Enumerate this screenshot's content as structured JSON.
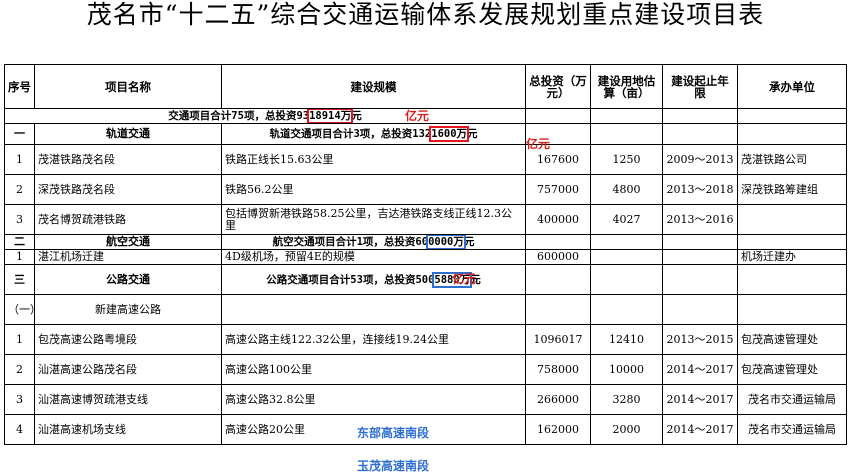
{
  "title": "茂名市“十二五”综合交通运输体系发展规划重点建设项目表",
  "headers": {
    "seq": "序号",
    "name": "项目名称",
    "scale": "建设规模",
    "invest": "总投资（万元）",
    "land": "建设用地估算（亩）",
    "years": "建设起止年限",
    "unit": "承办单位"
  },
  "total_row": {
    "prefix": "交通项目合计75项，总投资93",
    "boxed": "18914万",
    "suffix": "元"
  },
  "sections": {
    "rail": {
      "seq": "一",
      "name": "轨道交通",
      "sum_prefix": "轨道交通项目合计3项，总投资132",
      "sum_boxed": "1600万",
      "sum_suffix": "元"
    },
    "air": {
      "seq": "二",
      "name": "航空交通",
      "sum_prefix": "航空交通项目合计1项，总投资60",
      "sum_boxed": "0000万",
      "sum_suffix": "元"
    },
    "road": {
      "seq": "三",
      "name": "公路交通",
      "sum_prefix": "公路交通项目合计53项，总投资500",
      "sum_boxed": "5880万",
      "sum_suffix": "元"
    },
    "expressway": {
      "seq": "（一）",
      "name": "新建高速公路"
    }
  },
  "rows": [
    {
      "seq": "1",
      "name": "茂湛铁路茂名段",
      "scale": "铁路正线长15.63公里",
      "invest": "167600",
      "land": "1250",
      "years": "2009～2013",
      "unit": "茂湛铁路公司"
    },
    {
      "seq": "2",
      "name": "深茂铁路茂名段",
      "scale": "铁路56.2公里",
      "invest": "757000",
      "land": "4800",
      "years": "2013～2018",
      "unit": "深茂铁路筹建组"
    },
    {
      "seq": "3",
      "name": "茂名博贺疏港铁路",
      "scale": "包括博贺新港铁路58.25公里，吉达港铁路支线正线12.3公里",
      "invest": "400000",
      "land": "4027",
      "years": "2013～2016",
      "unit": ""
    },
    {
      "seq": "1",
      "name": "湛江机场迁建",
      "scale": "4D级机场，预留4E的规模",
      "invest": "600000",
      "land": "",
      "years": "",
      "unit": "机场迁建办"
    },
    {
      "seq": "1",
      "name": "包茂高速公路粤境段",
      "scale": "高速公路主线122.32公里，连接线19.24公里",
      "invest": "1096017",
      "land": "12410",
      "years": "2013～2015",
      "unit": "包茂高速管理处"
    },
    {
      "seq": "2",
      "name": "汕湛高速公路茂名段",
      "scale": "高速公路100公里",
      "invest": "758000",
      "land": "10000",
      "years": "2014～2017",
      "unit": "包茂高速管理处"
    },
    {
      "seq": "3",
      "name": "汕湛高速博贺疏港支线",
      "scale": "高速公路32.8公里",
      "invest": "266000",
      "land": "3280",
      "years": "2014～2017",
      "unit": "茂名市交通运输局"
    },
    {
      "seq": "4",
      "name": "汕湛高速机场支线",
      "scale": "高速公路20公里",
      "invest": "162000",
      "land": "2000",
      "years": "2014～2017",
      "unit": "茂名市交通运输局"
    }
  ],
  "annotations": {
    "total_unit": "亿元",
    "rail_unit": "亿元",
    "air_unit": "亿元",
    "note_east": "东部高速南段",
    "note_yumao": "玉茂高速南段"
  },
  "colors": {
    "red_box": "#e3161d",
    "blue_box": "#2c6fd1",
    "red_text": "#d61f1f",
    "blue_text": "#2f6fd0"
  }
}
